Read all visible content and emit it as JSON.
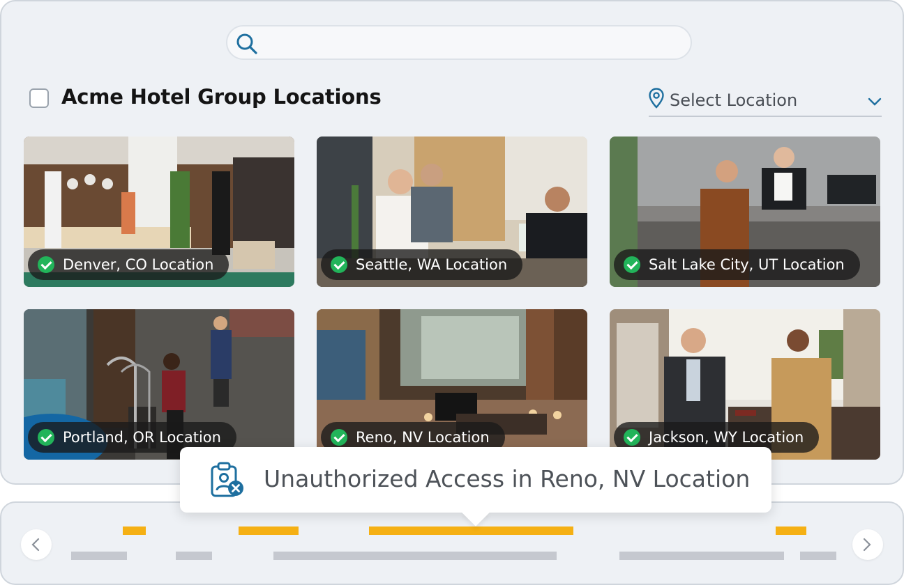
{
  "search": {
    "placeholder": "",
    "value": ""
  },
  "header": {
    "title": "Acme Hotel Group Locations"
  },
  "location_select": {
    "label": "Select Location"
  },
  "cards": [
    {
      "label": "Denver, CO Location",
      "status": "verified"
    },
    {
      "label": "Seattle, WA Location",
      "status": "verified"
    },
    {
      "label": "Salt Lake City, UT Location",
      "status": "verified"
    },
    {
      "label": "Portland, OR Location",
      "status": "verified"
    },
    {
      "label": "Reno, NV Location",
      "status": "verified"
    },
    {
      "label": "Jackson, WY Location",
      "status": "verified"
    }
  ],
  "alert": {
    "message": "Unauthorized Access in Reno, NV Location"
  },
  "colors": {
    "accent": "#1e6f9f",
    "check": "#22b45a",
    "alert_bar": "#f5b014",
    "normal_bar": "#c5c8cf"
  }
}
